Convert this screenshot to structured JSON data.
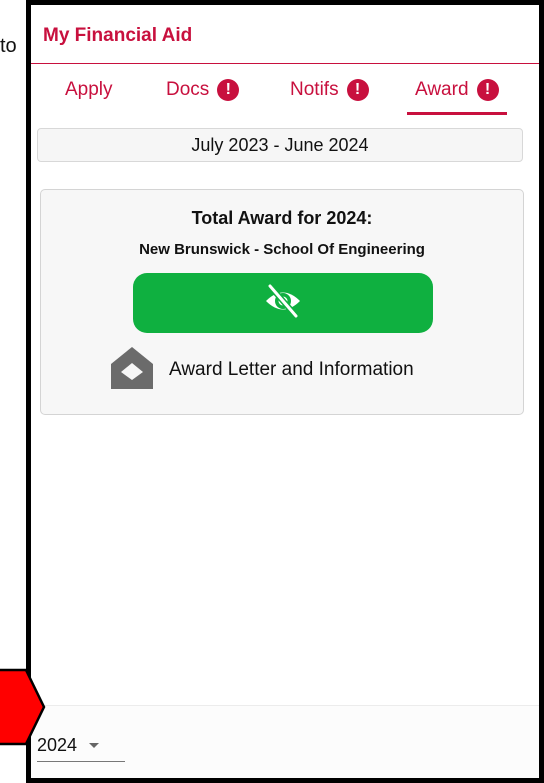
{
  "background": {
    "fragment": "to"
  },
  "app": {
    "title": "My Financial Aid"
  },
  "tabs": [
    {
      "label": "Apply",
      "alert": false
    },
    {
      "label": "Docs",
      "alert": true,
      "alert_glyph": "!"
    },
    {
      "label": "Notifs",
      "alert": true,
      "alert_glyph": "!"
    },
    {
      "label": "Award",
      "alert": true,
      "alert_glyph": "!",
      "active": true
    }
  ],
  "award": {
    "period": "July 2023 - June 2024",
    "title": "Total Award for 2024:",
    "school": "New Brunswick - School Of Engineering",
    "show_icon": "eye-slash-icon",
    "letter_icon": "envelope-open-icon",
    "letter_label": "Award Letter and Information"
  },
  "footer": {
    "year_value": "2024"
  },
  "colors": {
    "brand": "#c8103e",
    "show_button": "#0fb040",
    "arrow": "#ff0000"
  }
}
